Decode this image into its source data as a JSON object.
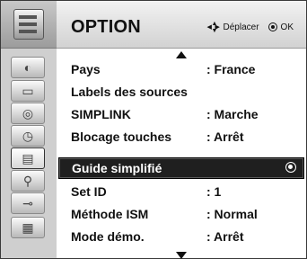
{
  "header": {
    "title": "OPTION",
    "hint_move": "Déplacer",
    "hint_ok": "OK"
  },
  "sidebar": {
    "icons": [
      "disc-icon",
      "display-icon",
      "audio-icon",
      "clock-icon",
      "option-icon",
      "lock-icon",
      "input-icon",
      "photo-icon"
    ],
    "active_index": 4
  },
  "menu": {
    "items": [
      {
        "label": "Pays",
        "value": ": France"
      },
      {
        "label": "Labels des sources",
        "value": ""
      },
      {
        "label": "SIMPLINK",
        "value": ": Marche"
      },
      {
        "label": "Blocage touches",
        "value": ": Arrêt"
      },
      {
        "label": "Guide simplifié",
        "value": ""
      },
      {
        "label": "Set ID",
        "value": ": 1"
      },
      {
        "label": "Méthode ISM",
        "value": ": Normal"
      },
      {
        "label": "Mode démo.",
        "value": ": Arrêt"
      }
    ],
    "selected_index": 4
  }
}
